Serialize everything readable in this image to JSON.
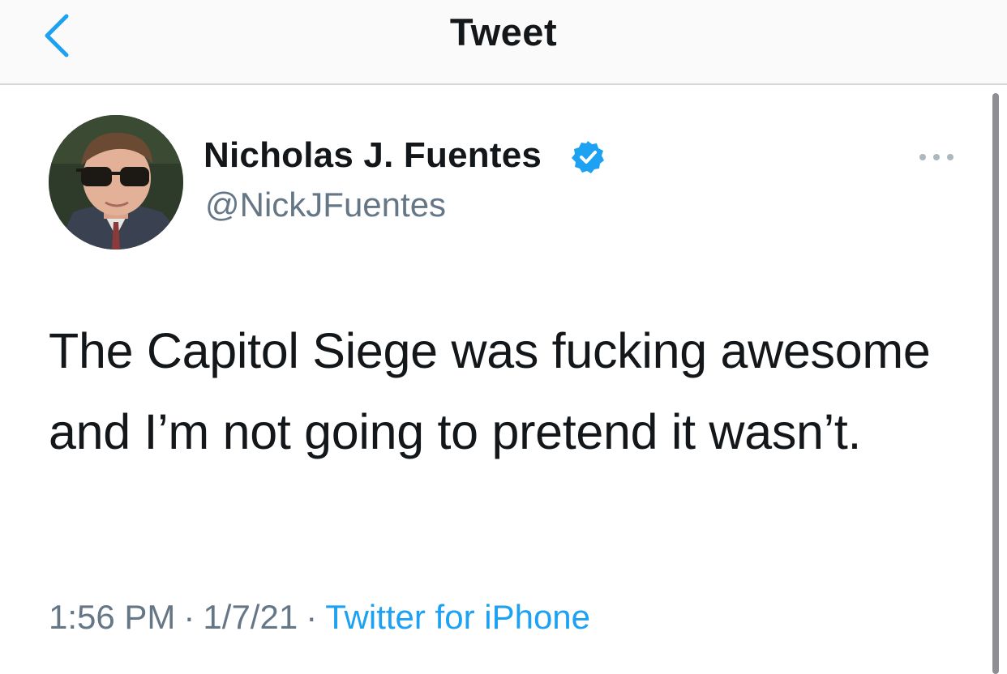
{
  "nav": {
    "title": "Tweet",
    "back_icon": "chevron-left-icon"
  },
  "tweet": {
    "author": {
      "name": "Nicholas J. Fuentes",
      "handle": "@NickJFuentes",
      "verified": true,
      "verified_icon": "verified-badge-icon"
    },
    "more_icon": "more-horizontal-icon",
    "text": "The Capitol Siege was fucking awesome and I’m not going to pretend it wasn’t.",
    "time": "1:56 PM",
    "date": "1/7/21",
    "separator": "·",
    "source": "Twitter for iPhone"
  },
  "colors": {
    "accent": "#1da1f2",
    "text_primary": "#14171a",
    "text_secondary": "#657786",
    "navbar_bg": "#fafafa"
  }
}
